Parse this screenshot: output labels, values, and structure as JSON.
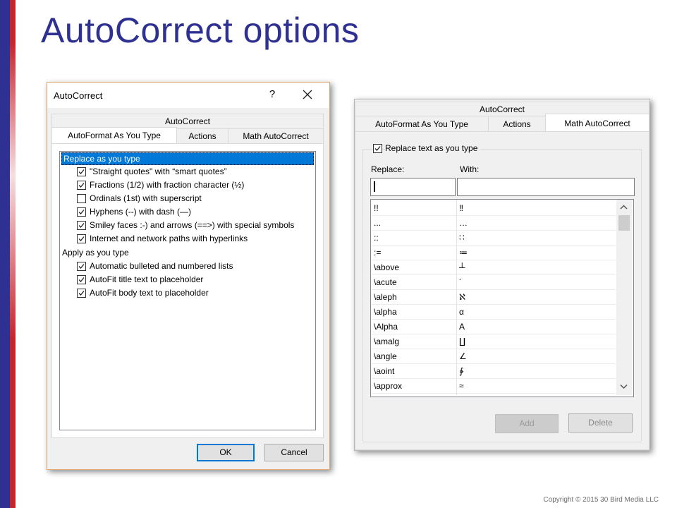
{
  "slide": {
    "title": "AutoCorrect options",
    "copyright": "Copyright © 2015 30 Bird Media LLC"
  },
  "dialog1": {
    "title": "AutoCorrect",
    "help_label": "?",
    "tab_top": "AutoCorrect",
    "tabs": [
      "AutoFormat As You Type",
      "Actions",
      "Math AutoCorrect"
    ],
    "groups": [
      {
        "label": "Replace as you type",
        "items": [
          {
            "label": "\"Straight quotes\" with “smart quotes”",
            "checked": true
          },
          {
            "label": "Fractions (1/2) with fraction character (½)",
            "checked": true
          },
          {
            "label": "Ordinals (1st) with superscript",
            "checked": false
          },
          {
            "label": "Hyphens (--) with dash (—)",
            "checked": true
          },
          {
            "label": "Smiley faces :-) and arrows (==>) with special symbols",
            "checked": true
          },
          {
            "label": "Internet and network paths with hyperlinks",
            "checked": true
          }
        ]
      },
      {
        "label": "Apply as you type",
        "items": [
          {
            "label": "Automatic bulleted and numbered lists",
            "checked": true
          },
          {
            "label": "AutoFit title text to placeholder",
            "checked": true
          },
          {
            "label": "AutoFit body text to placeholder",
            "checked": true
          }
        ]
      }
    ],
    "ok_label": "OK",
    "cancel_label": "Cancel"
  },
  "dialog2": {
    "tab_top": "AutoCorrect",
    "tabs": [
      "AutoFormat As You Type",
      "Actions",
      "Math AutoCorrect"
    ],
    "replace_checkbox_label": "Replace text as you type",
    "replace_checked": true,
    "replace_label": "Replace:",
    "with_label": "With:",
    "rows": [
      {
        "replace": "!!",
        "with": "‼"
      },
      {
        "replace": "...",
        "with": "…"
      },
      {
        "replace": "::",
        "with": "∷"
      },
      {
        "replace": ":=",
        "with": "≔"
      },
      {
        "replace": "\\above",
        "with": "┴"
      },
      {
        "replace": "\\acute",
        "with": "´"
      },
      {
        "replace": "\\aleph",
        "with": "ℵ"
      },
      {
        "replace": "\\alpha",
        "with": "α"
      },
      {
        "replace": "\\Alpha",
        "with": "Α"
      },
      {
        "replace": "\\amalg",
        "with": "∐"
      },
      {
        "replace": "\\angle",
        "with": "∠"
      },
      {
        "replace": "\\aoint",
        "with": "∳"
      },
      {
        "replace": "\\approx",
        "with": "≈"
      }
    ],
    "add_label": "Add",
    "delete_label": "Delete"
  }
}
